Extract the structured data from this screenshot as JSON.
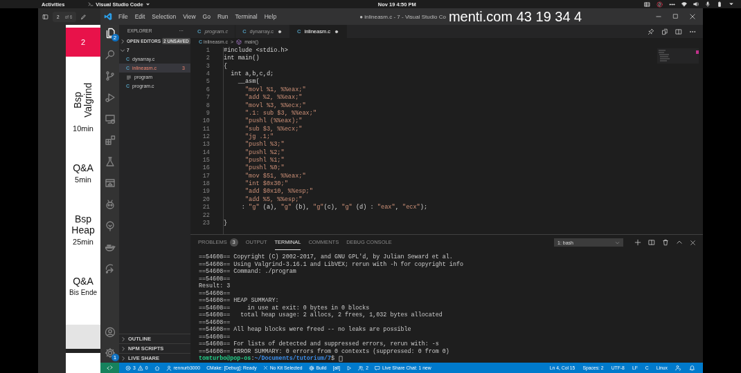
{
  "top_bar": {
    "activities": "Activities",
    "app": "Visual Studio Code",
    "clock": "Nov 19  4:50 PM"
  },
  "pdf_viewer": {
    "page": "2",
    "page_count": "of 6",
    "slides": [
      {
        "kind": "number",
        "title": "2"
      },
      {
        "kind": "vertical",
        "title": "Bsp Valgrind",
        "note": "10min"
      },
      {
        "kind": "plain",
        "title": "Q&A",
        "note": "5min"
      },
      {
        "kind": "plain",
        "title": "Bsp Heap",
        "note": "25min"
      },
      {
        "kind": "plain",
        "title": "Q&A",
        "note": "Bis Ende"
      }
    ]
  },
  "window": {
    "menu": [
      "File",
      "Edit",
      "Selection",
      "View",
      "Go",
      "Run",
      "Terminal",
      "Help"
    ],
    "title": "● inlineasm.c - 7 - Visual Studio Co"
  },
  "overlay": "menti.com 43 19 34 4",
  "activity_bar": [
    {
      "kind": "files",
      "selected": true,
      "badge": "2"
    },
    {
      "kind": "search",
      "selected": false
    },
    {
      "kind": "source-control",
      "selected": false
    },
    {
      "kind": "run",
      "selected": false
    },
    {
      "kind": "remote",
      "selected": false
    },
    {
      "kind": "extensions",
      "selected": false
    },
    {
      "kind": "flask",
      "selected": false
    },
    {
      "kind": "preview",
      "selected": false
    },
    {
      "kind": "alien",
      "selected": false
    },
    {
      "kind": "tree",
      "selected": false
    },
    {
      "kind": "whale",
      "selected": false
    },
    {
      "kind": "share",
      "selected": false
    }
  ],
  "activity_bottom": [
    {
      "kind": "account"
    },
    {
      "kind": "gear",
      "badge": "1"
    }
  ],
  "sidebar": {
    "title": "EXPLORER",
    "more": "···",
    "open_editors": {
      "label": "OPEN EDITORS",
      "badge": "2 UNSAVED",
      "expanded": false
    },
    "folder": {
      "label": "7",
      "expanded": true,
      "files": [
        {
          "name": "dynarray.c",
          "kind": "c",
          "icon": "C",
          "selected": false
        },
        {
          "name": "inlineasm.c",
          "kind": "c",
          "icon": "C",
          "selected": true,
          "problems": "3"
        },
        {
          "name": "program",
          "kind": "binary",
          "selected": false
        },
        {
          "name": "program.c",
          "kind": "c",
          "icon": "C",
          "selected": false
        }
      ]
    },
    "bottom_sections": [
      {
        "label": "OUTLINE",
        "expanded": false
      },
      {
        "label": "NPM SCRIPTS",
        "expanded": false
      },
      {
        "label": "LIVE SHARE",
        "expanded": false
      }
    ]
  },
  "editor": {
    "tabs": [
      {
        "icon": "C",
        "label": "program.c",
        "preview": true,
        "dirty": false,
        "selected": false
      },
      {
        "icon": "C",
        "label": "dynarray.c",
        "preview": false,
        "dirty": true,
        "selected": false
      },
      {
        "icon": "C",
        "label": "inlineasm.c",
        "preview": false,
        "dirty": true,
        "selected": true
      }
    ],
    "breadcrumb": {
      "icon": "C",
      "file": "inlineasm.c",
      "separator": ">",
      "symbol": "main()"
    },
    "lines": [
      {
        "number": "1",
        "code": "#include <stdio.h>"
      },
      {
        "number": "2",
        "code": "int main()"
      },
      {
        "number": "3",
        "code": "{"
      },
      {
        "number": "4",
        "code": "  int a,b,c,d;"
      },
      {
        "number": "5",
        "code": "    __asm("
      },
      {
        "number": "6",
        "code": "      \"movl %1, %%eax;\""
      },
      {
        "number": "7",
        "code": "      \"add %2, %%eax;\""
      },
      {
        "number": "8",
        "code": "      \"movl %3, %%ecx;\""
      },
      {
        "number": "9",
        "code": "      \".1: sub $3, %%eax;\""
      },
      {
        "number": "10",
        "code": "      \"pushl (%%eax);\""
      },
      {
        "number": "11",
        "code": "      \"sub $3, %%ecx;\""
      },
      {
        "number": "12",
        "code": "      \"jg .1;\""
      },
      {
        "number": "13",
        "code": "      \"pushl %3;\""
      },
      {
        "number": "14",
        "code": "      \"pushl %2;\""
      },
      {
        "number": "15",
        "code": "      \"pushl %1;\""
      },
      {
        "number": "16",
        "code": "      \"pushl %0;\""
      },
      {
        "number": "17",
        "code": "      \"mov $51, %%eax;\""
      },
      {
        "number": "18",
        "code": "      \"int $0x30;\""
      },
      {
        "number": "19",
        "code": "      \"add $0x10, %%esp;\""
      },
      {
        "number": "20",
        "code": "      \"add %5, %%esp;\""
      },
      {
        "number": "21",
        "code": "     : \"g\" (a), \"g\" (b), \"g\"(c), \"g\" (d) : \"eax\", \"ecx\");"
      },
      {
        "number": "22"
      },
      {
        "number": "23",
        "code": "}"
      }
    ]
  },
  "panel": {
    "tabs": [
      {
        "label": "PROBLEMS",
        "badge": "3",
        "selected": false
      },
      {
        "label": "OUTPUT",
        "selected": false
      },
      {
        "label": "TERMINAL",
        "selected": true
      },
      {
        "label": "COMMENTS",
        "selected": false
      },
      {
        "label": "DEBUG CONSOLE",
        "selected": false
      }
    ],
    "terminal_select": "1: bash",
    "terminal": [
      "==54608== Copyright (C) 2002-2017, and GNU GPL'd, by Julian Seward et al.",
      "==54608== Using Valgrind-3.16.1 and LibVEX; rerun with -h for copyright info",
      "==54608== Command: ./program",
      "==54608==",
      "Result: 3",
      "==54608==",
      "==54608== HEAP SUMMARY:",
      "==54608==     in use at exit: 0 bytes in 0 blocks",
      "==54608==   total heap usage: 2 allocs, 2 frees, 1,032 bytes allocated",
      "==54608==",
      "==54608== All heap blocks were freed -- no leaks are possible",
      "==54608==",
      "==54608== For lists of detected and suppressed errors, rerun with: -s",
      "==54608== ERROR SUMMARY: 0 errors from 0 contexts (suppressed: 0 from 0)"
    ],
    "prompt": {
      "user": "tomturbo@pop-os",
      "separator": ":",
      "path": "~/Documents/tutorium/7",
      "suffix": "$"
    }
  },
  "status_bar": {
    "left": [
      {
        "kind": "remote"
      },
      {
        "kind": "problems",
        "errors": "3",
        "warnings": "0"
      },
      {
        "kind": "home"
      },
      {
        "kind": "account",
        "text": "rennurb3000"
      },
      {
        "kind": "text",
        "text": "CMake: [Debug]: Ready"
      },
      {
        "kind": "kit",
        "text": "No Kit Selected"
      },
      {
        "kind": "build",
        "text": "Build"
      },
      {
        "kind": "text",
        "text": "[all]"
      },
      {
        "kind": "debug"
      },
      {
        "kind": "people",
        "text": "2"
      },
      {
        "kind": "chat",
        "text": "Live Share Chat: 1 new"
      }
    ],
    "right": [
      {
        "kind": "text",
        "text": "Ln 4, Col 15"
      },
      {
        "kind": "text",
        "text": "Spaces: 2"
      },
      {
        "kind": "text",
        "text": "UTF-8"
      },
      {
        "kind": "text",
        "text": "LF"
      },
      {
        "kind": "text",
        "text": "C"
      },
      {
        "kind": "text",
        "text": "Linux"
      },
      {
        "kind": "feedback"
      },
      {
        "kind": "bell"
      }
    ]
  }
}
